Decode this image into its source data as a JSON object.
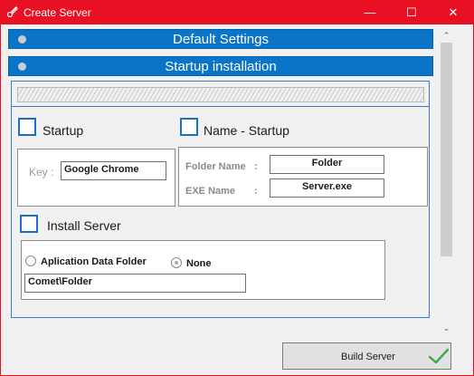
{
  "window": {
    "title": "Create Server",
    "minimize_glyph": "—",
    "maximize_glyph": "☐",
    "close_glyph": "✕",
    "accent_color": "#e81123",
    "section_color": "#0a74c9"
  },
  "sections": {
    "default_settings": "Default Settings",
    "startup_installation": "Startup installation"
  },
  "startup": {
    "checkbox_label": "Startup",
    "checked": false,
    "key_label": "Key :",
    "key_value": "Google Chrome"
  },
  "name_startup": {
    "checkbox_label": "Name - Startup",
    "checked": false,
    "folder_name_label": "Folder Name",
    "folder_name_sep": ":",
    "folder_name_value": "Folder",
    "exe_name_label": "EXE Name",
    "exe_name_sep": ":",
    "exe_name_value": "Server.exe"
  },
  "install_server": {
    "checkbox_label": "Install Server",
    "checked": false,
    "option_app_data": "Aplication Data Folder",
    "option_none": "None",
    "selected_option": "None",
    "path_value": "Comet\\Folder"
  },
  "scrollbar": {
    "up_glyph": "⌃",
    "down_glyph": "⌄"
  },
  "footer": {
    "build_label": "Build Server",
    "check_icon": "check-icon"
  }
}
